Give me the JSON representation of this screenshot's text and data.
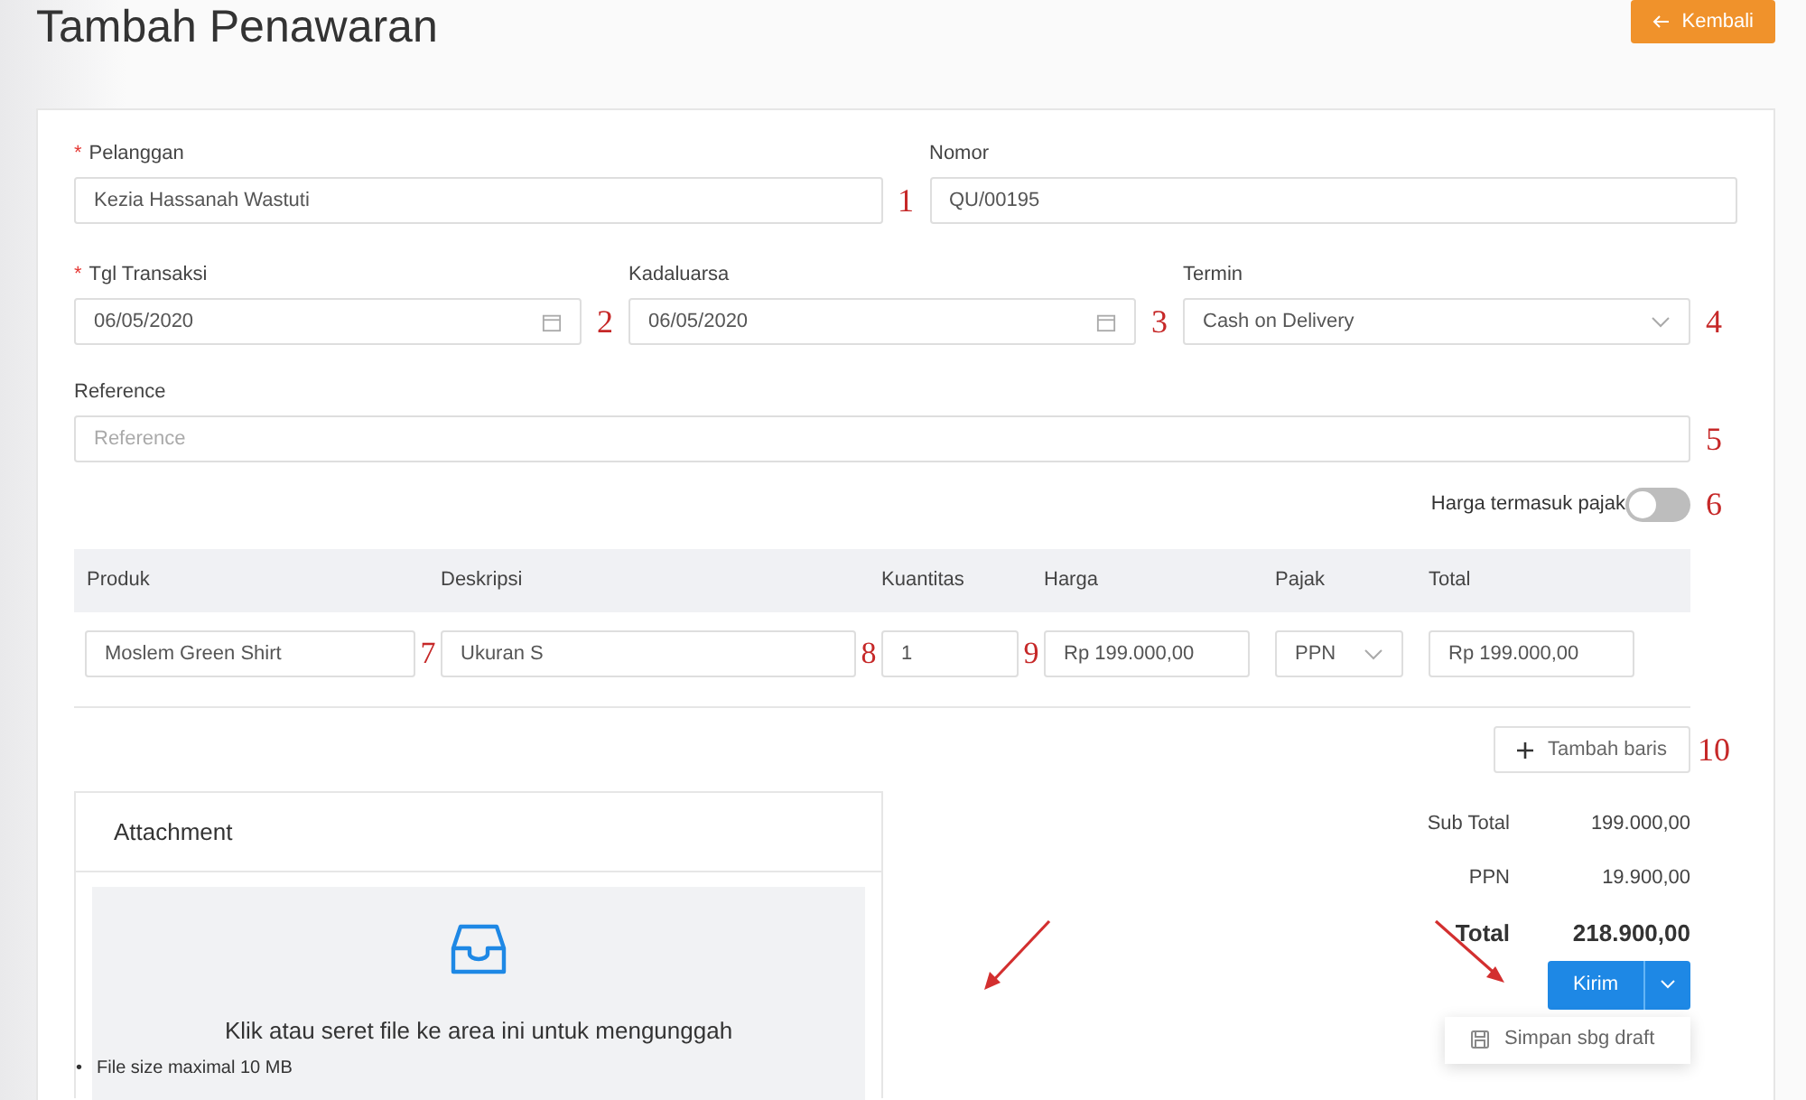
{
  "page_title": "Tambah Penawaran",
  "back_button": {
    "label": "Kembali"
  },
  "field_rows": [
    [
      {
        "label": "Pelanggan",
        "required_mark": "*",
        "kind": "text",
        "value": "Kezia Hassanah Wastuti",
        "marker": "1"
      },
      {
        "label": "Nomor",
        "kind": "text",
        "value": "QU/00195"
      }
    ],
    [
      {
        "label": "Tgl Transaksi",
        "required_mark": "*",
        "kind": "date",
        "value": "06/05/2020",
        "marker": "2"
      },
      {
        "label": "Kadaluarsa",
        "kind": "date",
        "value": "06/05/2020",
        "marker": "3"
      },
      {
        "label": "Termin",
        "kind": "select",
        "value": "Cash on Delivery",
        "marker": "4"
      }
    ],
    [
      {
        "label": "Reference",
        "kind": "text",
        "placeholder": "Reference",
        "marker": "5"
      }
    ]
  ],
  "tax_toggle": {
    "label": "Harga termasuk pajak",
    "on": false,
    "marker": "6"
  },
  "table": {
    "columns": [
      "Produk",
      "Deskripsi",
      "Kuantitas",
      "Harga",
      "Pajak",
      "Total"
    ],
    "rows": [
      [
        {
          "kind": "text",
          "value": "Moslem Green Shirt",
          "marker": "7"
        },
        {
          "kind": "text",
          "value": "Ukuran S",
          "marker": "8"
        },
        {
          "kind": "text",
          "value": "1",
          "marker": "9"
        },
        {
          "kind": "text",
          "value": "Rp 199.000,00"
        },
        {
          "kind": "select",
          "value": "PPN"
        },
        {
          "kind": "text",
          "value": "Rp 199.000,00"
        }
      ]
    ]
  },
  "add_row_button": {
    "label": "Tambah baris",
    "marker": "10"
  },
  "attachment": {
    "title": "Attachment",
    "drop_text": "Klik atau seret file ke area ini untuk mengunggah",
    "notes": [
      {
        "bullet": "•",
        "text": "File size maximal 10 MB"
      }
    ]
  },
  "totals": [
    {
      "label": "Sub Total",
      "value": "199.000,00",
      "emphasis": false
    },
    {
      "label": "PPN",
      "value": "19.900,00",
      "emphasis": false
    },
    {
      "label": "Total",
      "value": "218.900,00",
      "emphasis": true
    }
  ],
  "submit": {
    "label": "Kirim",
    "menu": [
      {
        "label": "Simpan sbg draft"
      }
    ]
  }
}
